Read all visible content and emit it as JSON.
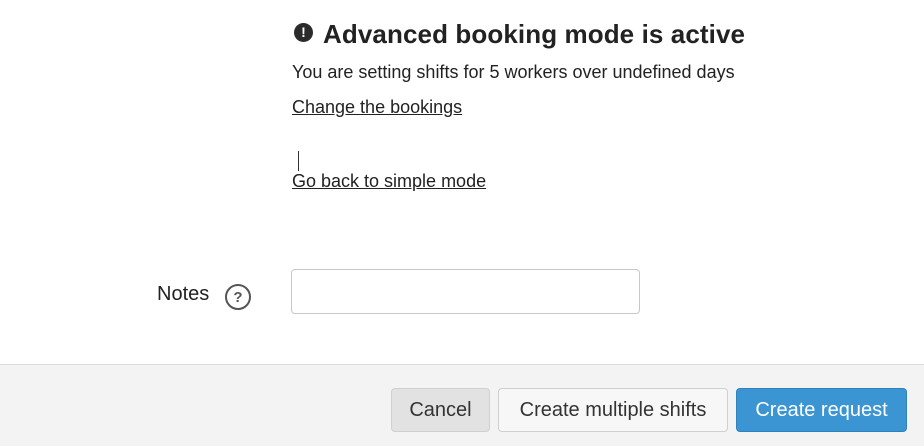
{
  "notice": {
    "icon": "exclamation-circle-icon",
    "title": "Advanced booking mode is active",
    "description": "You are setting shifts for 5 workers over undefined days",
    "change_link": "Change the bookings",
    "simple_mode_link": "Go back to simple mode"
  },
  "notes": {
    "label": "Notes",
    "help_icon": "question-circle-icon",
    "help_glyph": "?",
    "value": "",
    "placeholder": ""
  },
  "footer": {
    "cancel_label": "Cancel",
    "multiple_label": "Create multiple shifts",
    "create_label": "Create request"
  },
  "colors": {
    "primary": "#3b95d3",
    "footer_bg": "#f3f3f3",
    "text": "#222222"
  }
}
